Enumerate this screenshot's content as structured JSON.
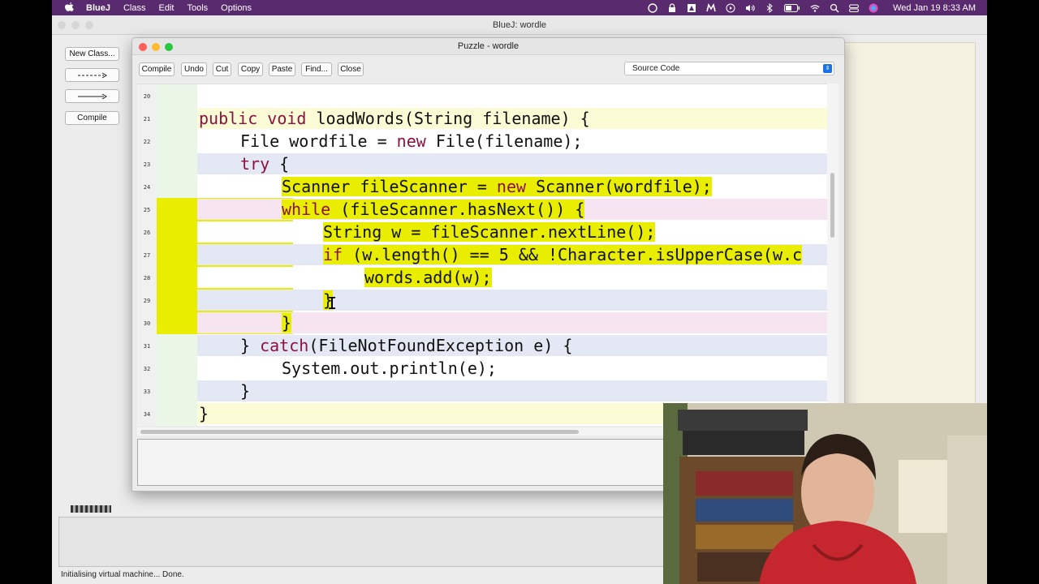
{
  "menubar": {
    "app": "BlueJ",
    "items": [
      "Class",
      "Edit",
      "Tools",
      "Options"
    ],
    "clock": "Wed Jan 19  8:33 AM",
    "status_icons": [
      "creative-cloud-icon",
      "lock-icon",
      "drive-icon",
      "malwarebytes-icon",
      "play-icon",
      "volume-icon",
      "bluetooth-icon",
      "battery-icon",
      "wifi-icon",
      "search-icon",
      "control-center-icon",
      "siri-icon"
    ]
  },
  "bluej": {
    "title": "BlueJ: wordle",
    "new_class": "New Class...",
    "compile": "Compile",
    "status": "Initialising virtual machine... Done."
  },
  "editor": {
    "title": "Puzzle - wordle",
    "toolbar": [
      "Compile",
      "Undo",
      "Cut",
      "Copy",
      "Paste",
      "Find...",
      "Close"
    ],
    "view_select": "Source Code",
    "lines": [
      {
        "n": "20",
        "text": ""
      },
      {
        "n": "21",
        "text": "public void loadWords(String filename) {"
      },
      {
        "n": "22",
        "text": "File wordfile = new File(filename);"
      },
      {
        "n": "23",
        "text": "try {"
      },
      {
        "n": "24",
        "text": "Scanner fileScanner = new Scanner(wordfile);"
      },
      {
        "n": "25",
        "text": "while (fileScanner.hasNext()) {"
      },
      {
        "n": "26",
        "text": "String w = fileScanner.nextLine();"
      },
      {
        "n": "27",
        "text": "if (w.length() == 5 && !Character.isUpperCase(w.c"
      },
      {
        "n": "28",
        "text": "words.add(w);"
      },
      {
        "n": "29",
        "text": "}"
      },
      {
        "n": "30",
        "text": "}"
      },
      {
        "n": "31",
        "text": "} catch(FileNotFoundException e) {"
      },
      {
        "n": "32",
        "text": "System.out.println(e);"
      },
      {
        "n": "33",
        "text": "}"
      },
      {
        "n": "34",
        "text": "}"
      }
    ]
  },
  "colors": {
    "menubar": "#5a2a6e",
    "selection": "#e9ed00",
    "keyword": "#8a1242"
  }
}
